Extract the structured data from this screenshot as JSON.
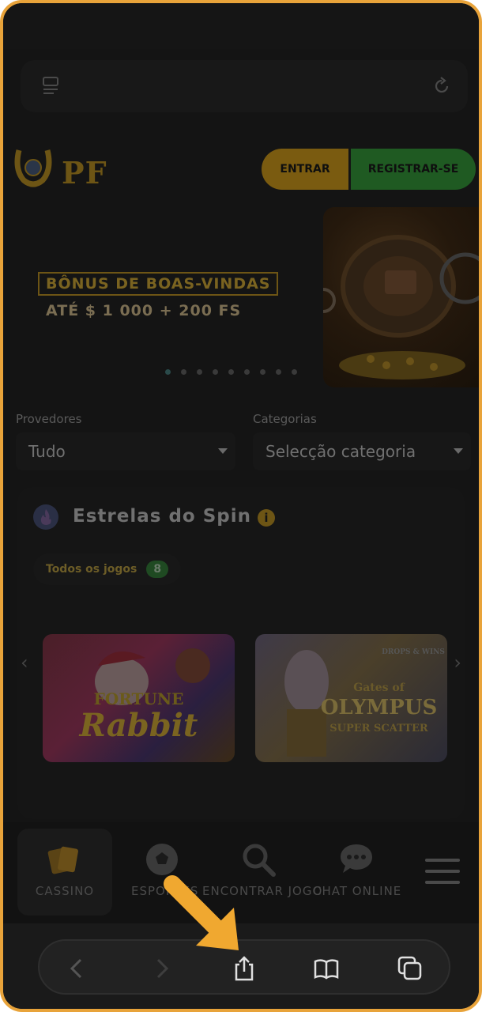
{
  "header": {
    "logo_text": "PF",
    "login_label": "ENTRAR",
    "register_label": "REGISTRAR-SE"
  },
  "banner": {
    "title": "BÔNUS DE BOAS-VINDAS",
    "subtitle": "ATÉ $ 1 000 + 200 FS",
    "slide_count": 9
  },
  "filters": {
    "providers_label": "Provedores",
    "providers_value": "Tudo",
    "categories_label": "Categorias",
    "categories_value": "Selecção categoria"
  },
  "section": {
    "title": "Estrelas do Spin",
    "chip_label": "Todos os jogos",
    "chip_count": "8",
    "games": [
      {
        "title_line1": "FORTUNE",
        "title_line2": "Rabbit"
      },
      {
        "title_line1": "Gates of",
        "title_line2": "OLYMPUS",
        "title_line3": "SUPER SCATTER",
        "badge": "DROPS & WINS"
      }
    ]
  },
  "bottom_nav": {
    "items": [
      {
        "label": "CASSINO",
        "icon": "cards-icon",
        "active": true
      },
      {
        "label": "ESPORTES",
        "icon": "soccer-ball-icon"
      },
      {
        "label": "ENCONTRAR JOGO",
        "icon": "search-icon"
      },
      {
        "label": "CHAT ONLINE",
        "icon": "chat-icon"
      }
    ]
  },
  "browser": {
    "icons": [
      "back-icon",
      "forward-icon",
      "share-icon",
      "bookmarks-icon",
      "tabs-icon"
    ]
  },
  "colors": {
    "frame": "#e8a33a",
    "pointer_arrow": "#f0a830",
    "login": "#7a5b10",
    "register": "#1f5a22"
  }
}
